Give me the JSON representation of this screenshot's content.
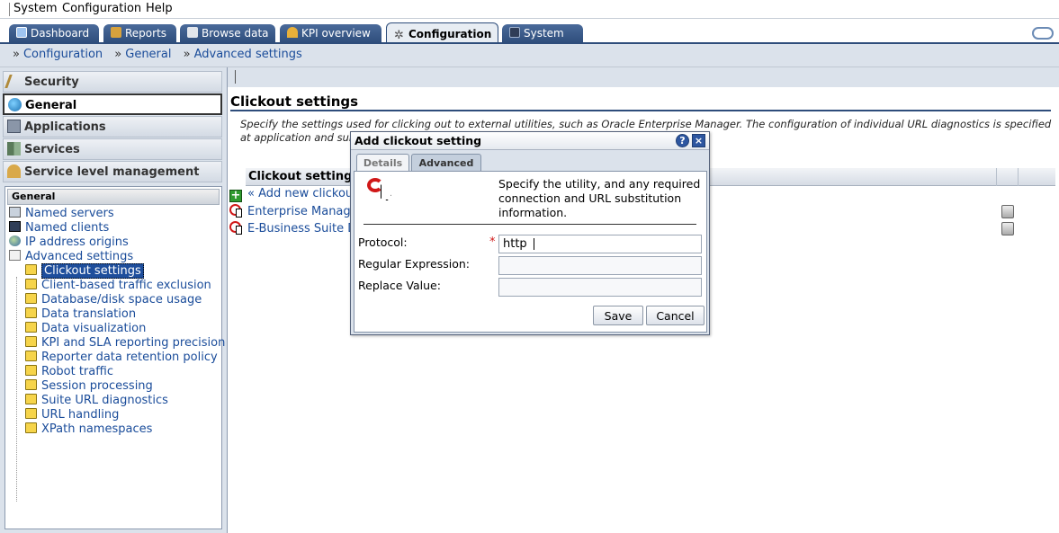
{
  "menubar": {
    "items": [
      "System",
      "Configuration",
      "Help"
    ]
  },
  "tabs": [
    {
      "label": "Dashboard",
      "icon": "dashboard-icon"
    },
    {
      "label": "Reports",
      "icon": "reports-icon"
    },
    {
      "label": "Browse data",
      "icon": "cube-icon"
    },
    {
      "label": "KPI overview",
      "icon": "gauge-icon"
    },
    {
      "label": "Configuration",
      "icon": "gear-icon",
      "active": true
    },
    {
      "label": "System",
      "icon": "monitor-icon"
    }
  ],
  "breadcrumb": [
    "Configuration",
    "General",
    "Advanced settings"
  ],
  "breadcrumb_sep": "»",
  "sidebar": {
    "sections": [
      {
        "label": "Security",
        "icon": "pen-icon"
      },
      {
        "label": "General",
        "icon": "globe-icon",
        "active": true
      },
      {
        "label": "Applications",
        "icon": "applications-icon"
      },
      {
        "label": "Services",
        "icon": "services-icon"
      },
      {
        "label": "Service level management",
        "icon": "gauge-icon"
      }
    ],
    "tree_header": "General",
    "tree_top": [
      {
        "label": "Named servers",
        "icon": "server-icon"
      },
      {
        "label": "Named clients",
        "icon": "client-icon"
      },
      {
        "label": "IP address origins",
        "icon": "globe-icon"
      },
      {
        "label": "Advanced settings",
        "icon": "document-icon"
      }
    ],
    "tree_children": [
      {
        "label": "Clickout settings",
        "selected": true
      },
      {
        "label": "Client-based traffic exclusion"
      },
      {
        "label": "Database/disk space usage"
      },
      {
        "label": "Data translation"
      },
      {
        "label": "Data visualization"
      },
      {
        "label": "KPI and SLA reporting precision"
      },
      {
        "label": "Reporter data retention policy"
      },
      {
        "label": "Robot traffic"
      },
      {
        "label": "Session processing"
      },
      {
        "label": "Suite URL diagnostics"
      },
      {
        "label": "URL handling"
      },
      {
        "label": "XPath namespaces"
      }
    ]
  },
  "content": {
    "title": "Clickout settings",
    "description": "Specify the settings used for clicking out to external utilities, such as Oracle Enterprise Manager. The configuration of individual URL diagnostics is specified at application and suite",
    "table_header": "Clickout setting",
    "add_link": "« Add new clickout",
    "rows": [
      "Enterprise Manage",
      "E-Business Suite D"
    ]
  },
  "dialog": {
    "title": "Add clickout setting",
    "help_glyph": "?",
    "close_glyph": "×",
    "tabs": [
      "Details",
      "Advanced"
    ],
    "info": "Specify the utility, and any required connection and URL substitution information.",
    "fields": [
      {
        "label": "Protocol:",
        "value": "http",
        "required": true
      },
      {
        "label": "Regular Expression:",
        "value": ""
      },
      {
        "label": "Replace Value:",
        "value": ""
      }
    ],
    "required_mark": "*",
    "save": "Save",
    "cancel": "Cancel"
  },
  "colors": {
    "accent": "#2e4d7b",
    "link": "#1a4c9a",
    "required": "#d01818"
  }
}
